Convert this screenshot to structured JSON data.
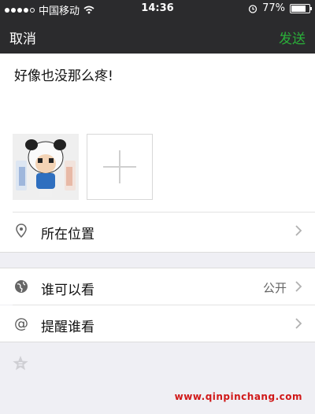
{
  "status_bar": {
    "carrier": "中国移动",
    "time": "14:36",
    "battery_text": "77%",
    "battery_level": 0.77
  },
  "nav": {
    "cancel_label": "取消",
    "send_label": "发送",
    "send_color": "#2aae39"
  },
  "post": {
    "text": "好像也没那么疼!"
  },
  "options": {
    "location_label": "所在位置",
    "visibility_label": "谁可以看",
    "visibility_value": "公开",
    "remind_label": "提醒谁看"
  },
  "watermark": "www.qinpinchang.com",
  "icons": [
    "location-pin-icon",
    "globe-icon",
    "at-icon",
    "chevron-right-icon",
    "star-icon",
    "wifi-icon",
    "alarm-icon",
    "add-photo-icon"
  ]
}
